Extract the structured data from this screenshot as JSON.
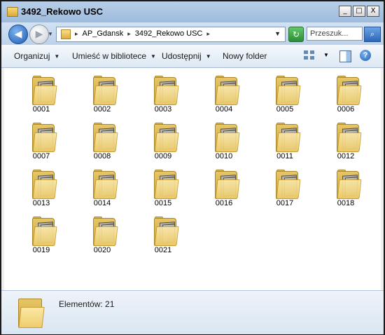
{
  "window": {
    "title": "3492_Rekowo USC",
    "buttons": {
      "minimize": "_",
      "maximize": "□",
      "close": "X"
    }
  },
  "address": {
    "breadcrumbs": [
      "AP_Gdansk",
      "3492_Rekowo USC"
    ],
    "search_placeholder": "Przeszuk..."
  },
  "toolbar": {
    "organize": "Organizuj",
    "library": "Umieść w bibliotece",
    "share": "Udostępnij",
    "new_folder": "Nowy folder"
  },
  "folders": [
    "0001",
    "0002",
    "0003",
    "0004",
    "0005",
    "0006",
    "0007",
    "0008",
    "0009",
    "0010",
    "0011",
    "0012",
    "0013",
    "0014",
    "0015",
    "0016",
    "0017",
    "0018",
    "0019",
    "0020",
    "0021"
  ],
  "status": {
    "text": "Elementów: 21"
  }
}
